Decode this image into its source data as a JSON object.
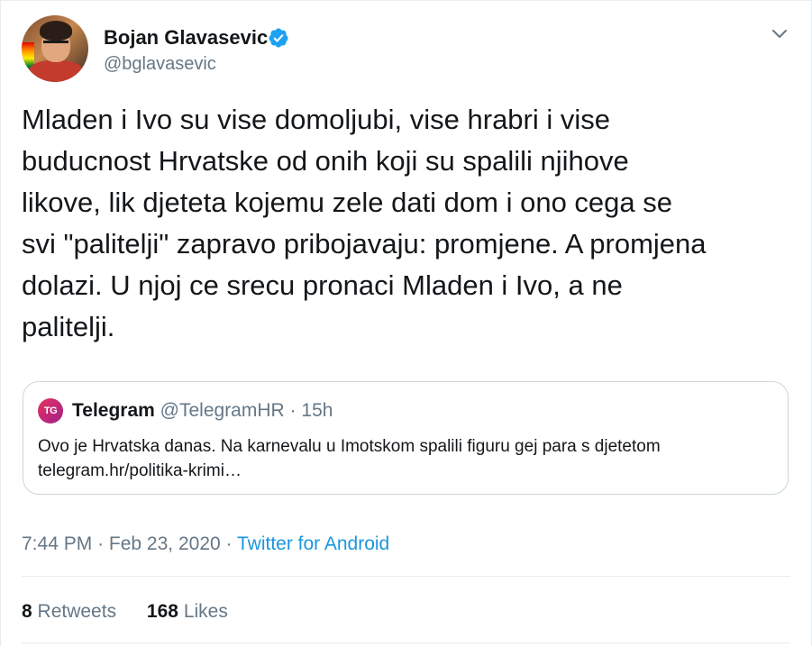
{
  "author": {
    "name": "Bojan Glavasevic",
    "handle": "@bglavasevic",
    "verified": true
  },
  "tweet": {
    "text": "Mladen i Ivo su vise domoljubi, vise hrabri i vise\nbuducnost Hrvatske od onih koji su spalili njihove\nlikove, lik djeteta kojemu zele dati dom i ono cega se\nsvi \"palitelji\" zapravo pribojavaju: promjene. A promjena\ndolazi. U njoj ce srecu pronaci Mladen i Ivo, a ne\npalitelji."
  },
  "quote": {
    "logo_text": "TG",
    "name": "Telegram",
    "handle": "@TelegramHR",
    "separator": "·",
    "time": "15h",
    "text": "Ovo je Hrvatska danas. Na karnevalu u Imotskom spalili figuru gej para s djetetom\ntelegram.hr/politika-krimi…"
  },
  "meta": {
    "time": "7:44 PM",
    "separator1": "·",
    "date": "Feb 23, 2020",
    "separator2": "·",
    "source": "Twitter for Android"
  },
  "stats": {
    "retweets_count": "8",
    "retweets_label": "Retweets",
    "likes_count": "168",
    "likes_label": "Likes"
  },
  "icons": {
    "verified": "verified-badge-icon",
    "menu": "chevron-down-icon"
  },
  "colors": {
    "accent": "#1da1f2",
    "link": "#1b95e0",
    "secondary_text": "#657786",
    "border": "#ccd6dd"
  }
}
